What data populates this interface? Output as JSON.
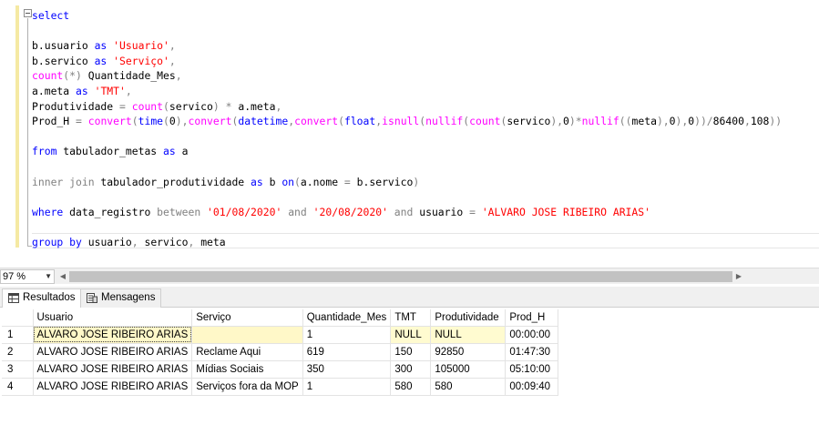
{
  "editor": {
    "lines": [
      [
        {
          "t": "select",
          "c": "kw"
        }
      ],
      [],
      [
        {
          "t": "b.usuario ",
          "c": ""
        },
        {
          "t": "as",
          "c": "kw"
        },
        {
          "t": " ",
          "c": ""
        },
        {
          "t": "'Usuario'",
          "c": "str"
        },
        {
          "t": ",",
          "c": "op"
        }
      ],
      [
        {
          "t": "b.servico ",
          "c": ""
        },
        {
          "t": "as",
          "c": "kw"
        },
        {
          "t": " ",
          "c": ""
        },
        {
          "t": "'Serviço'",
          "c": "str"
        },
        {
          "t": ",",
          "c": "op"
        }
      ],
      [
        {
          "t": "count",
          "c": "fn"
        },
        {
          "t": "(*)",
          "c": "op"
        },
        {
          "t": " Quantidade_Mes",
          "c": ""
        },
        {
          "t": ",",
          "c": "op"
        }
      ],
      [
        {
          "t": "a.meta ",
          "c": ""
        },
        {
          "t": "as",
          "c": "kw"
        },
        {
          "t": " ",
          "c": ""
        },
        {
          "t": "'TMT'",
          "c": "str"
        },
        {
          "t": ",",
          "c": "op"
        }
      ],
      [
        {
          "t": "Produtividade ",
          "c": ""
        },
        {
          "t": "=",
          "c": "op"
        },
        {
          "t": " ",
          "c": ""
        },
        {
          "t": "count",
          "c": "fn"
        },
        {
          "t": "(",
          "c": "op"
        },
        {
          "t": "servico",
          "c": ""
        },
        {
          "t": ")",
          "c": "op"
        },
        {
          "t": " ",
          "c": ""
        },
        {
          "t": "*",
          "c": "op"
        },
        {
          "t": " a.meta",
          "c": ""
        },
        {
          "t": ",",
          "c": "op"
        }
      ],
      [
        {
          "t": "Prod_H ",
          "c": ""
        },
        {
          "t": "=",
          "c": "op"
        },
        {
          "t": " ",
          "c": ""
        },
        {
          "t": "convert",
          "c": "fn"
        },
        {
          "t": "(",
          "c": "op"
        },
        {
          "t": "time",
          "c": "kw"
        },
        {
          "t": "(",
          "c": "op"
        },
        {
          "t": "0",
          "c": ""
        },
        {
          "t": "),",
          "c": "op"
        },
        {
          "t": "convert",
          "c": "fn"
        },
        {
          "t": "(",
          "c": "op"
        },
        {
          "t": "datetime",
          "c": "kw"
        },
        {
          "t": ",",
          "c": "op"
        },
        {
          "t": "convert",
          "c": "fn"
        },
        {
          "t": "(",
          "c": "op"
        },
        {
          "t": "float",
          "c": "kw"
        },
        {
          "t": ",",
          "c": "op"
        },
        {
          "t": "isnull",
          "c": "fn"
        },
        {
          "t": "(",
          "c": "op"
        },
        {
          "t": "nullif",
          "c": "fn"
        },
        {
          "t": "(",
          "c": "op"
        },
        {
          "t": "count",
          "c": "fn"
        },
        {
          "t": "(",
          "c": "op"
        },
        {
          "t": "servico",
          "c": ""
        },
        {
          "t": "),",
          "c": "op"
        },
        {
          "t": "0",
          "c": ""
        },
        {
          "t": ")*",
          "c": "op"
        },
        {
          "t": "nullif",
          "c": "fn"
        },
        {
          "t": "((",
          "c": "op"
        },
        {
          "t": "meta",
          "c": ""
        },
        {
          "t": "),",
          "c": "op"
        },
        {
          "t": "0",
          "c": ""
        },
        {
          "t": "),",
          "c": "op"
        },
        {
          "t": "0",
          "c": ""
        },
        {
          "t": "))/",
          "c": "op"
        },
        {
          "t": "86400",
          "c": ""
        },
        {
          "t": ",",
          "c": "op"
        },
        {
          "t": "108",
          "c": ""
        },
        {
          "t": "))",
          "c": "op"
        }
      ],
      [],
      [
        {
          "t": "from",
          "c": "kw"
        },
        {
          "t": " tabulador_metas ",
          "c": ""
        },
        {
          "t": "as",
          "c": "kw"
        },
        {
          "t": " a",
          "c": ""
        }
      ],
      [],
      [
        {
          "t": "inner join",
          "c": "op"
        },
        {
          "t": " tabulador_produtividade ",
          "c": ""
        },
        {
          "t": "as",
          "c": "kw"
        },
        {
          "t": " b ",
          "c": ""
        },
        {
          "t": "on",
          "c": "kw"
        },
        {
          "t": "(",
          "c": "op"
        },
        {
          "t": "a.nome ",
          "c": ""
        },
        {
          "t": "=",
          "c": "op"
        },
        {
          "t": " b.servico",
          "c": ""
        },
        {
          "t": ")",
          "c": "op"
        }
      ],
      [],
      [
        {
          "t": "where",
          "c": "kw"
        },
        {
          "t": " data_registro ",
          "c": ""
        },
        {
          "t": "between",
          "c": "op"
        },
        {
          "t": " ",
          "c": ""
        },
        {
          "t": "'01/08/2020'",
          "c": "str"
        },
        {
          "t": " ",
          "c": ""
        },
        {
          "t": "and",
          "c": "op"
        },
        {
          "t": " ",
          "c": ""
        },
        {
          "t": "'20/08/2020'",
          "c": "str"
        },
        {
          "t": " ",
          "c": ""
        },
        {
          "t": "and",
          "c": "op"
        },
        {
          "t": " usuario ",
          "c": ""
        },
        {
          "t": "=",
          "c": "op"
        },
        {
          "t": " ",
          "c": ""
        },
        {
          "t": "'ALVARO JOSE RIBEIRO ARIAS'",
          "c": "str"
        }
      ],
      [],
      [
        {
          "t": "group by",
          "c": "kw"
        },
        {
          "t": " usuario",
          "c": ""
        },
        {
          "t": ",",
          "c": "op"
        },
        {
          "t": " servico",
          "c": ""
        },
        {
          "t": ",",
          "c": "op"
        },
        {
          "t": " meta",
          "c": ""
        }
      ]
    ]
  },
  "statusbar": {
    "zoom": "97 %"
  },
  "tabs": {
    "results": "Resultados",
    "messages": "Mensagens"
  },
  "grid": {
    "columns": [
      "Usuario",
      "Serviço",
      "Quantidade_Mes",
      "TMT",
      "Produtividade",
      "Prod_H"
    ],
    "rows": [
      {
        "n": "1",
        "cells": [
          "ALVARO JOSE RIBEIRO ARIAS",
          "",
          "1",
          "NULL",
          "NULL",
          "00:00:00"
        ]
      },
      {
        "n": "2",
        "cells": [
          "ALVARO JOSE RIBEIRO ARIAS",
          "Reclame Aqui",
          "619",
          "150",
          "92850",
          "01:47:30"
        ]
      },
      {
        "n": "3",
        "cells": [
          "ALVARO JOSE RIBEIRO ARIAS",
          "Mídias Sociais",
          "350",
          "300",
          "105000",
          "05:10:00"
        ]
      },
      {
        "n": "4",
        "cells": [
          "ALVARO JOSE RIBEIRO ARIAS",
          "Serviços fora da MOP",
          "1",
          "580",
          "580",
          "00:09:40"
        ]
      }
    ]
  },
  "colors": {
    "keyword": "#0000ff",
    "function": "#ff00ff",
    "string": "#ff0000",
    "operator": "#808080",
    "null_cell": "#fffbd0"
  }
}
